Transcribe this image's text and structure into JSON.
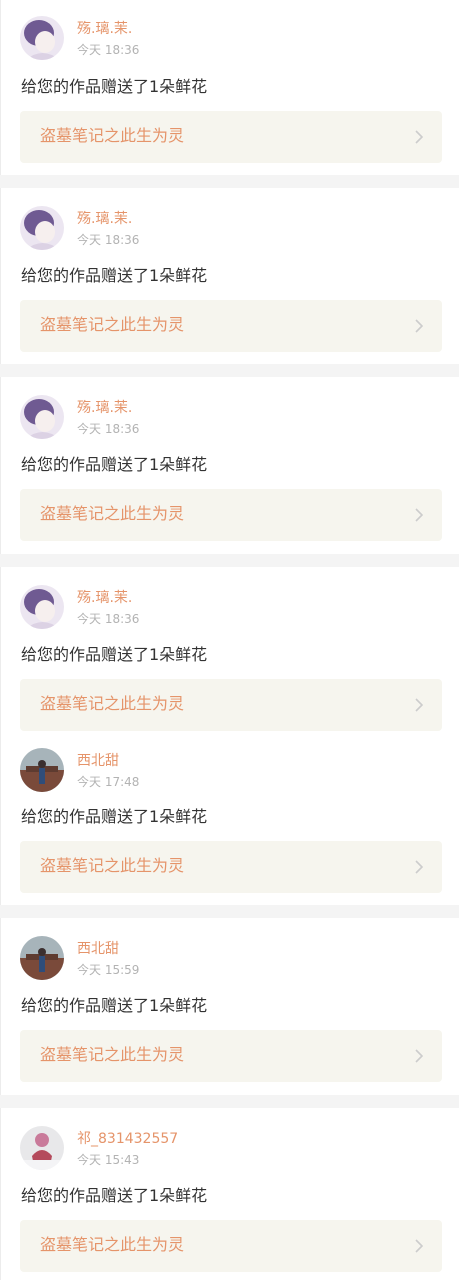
{
  "colors": {
    "background": "#f4f4f4",
    "entry_background": "#ffffff",
    "accent": "#e5946a",
    "card_background": "#f6f5ee",
    "timestamp": "#b3b3b3",
    "message": "#333333",
    "chevron": "#cccccc"
  },
  "entries": [
    {
      "avatar": "avatar-purple-hair-icon",
      "username": "殇.璃.茉.",
      "time": "今天 18:36",
      "message": "给您的作品赠送了1朵鲜花",
      "work_title": "盗墓笔记之此生为灵"
    },
    {
      "avatar": "avatar-purple-hair-icon",
      "username": "殇.璃.茉.",
      "time": "今天 18:36",
      "message": "给您的作品赠送了1朵鲜花",
      "work_title": "盗墓笔记之此生为灵"
    },
    {
      "avatar": "avatar-purple-hair-icon",
      "username": "殇.璃.茉.",
      "time": "今天 18:36",
      "message": "给您的作品赠送了1朵鲜花",
      "work_title": "盗墓笔记之此生为灵"
    },
    {
      "avatar": "avatar-purple-hair-icon",
      "username": "殇.璃.茉.",
      "time": "今天 18:36",
      "message": "给您的作品赠送了1朵鲜花",
      "work_title": "盗墓笔记之此生为灵"
    },
    {
      "avatar": "avatar-outdoor-photo-icon",
      "username": "西北甜",
      "time": "今天 17:48",
      "message": "给您的作品赠送了1朵鲜花",
      "work_title": "盗墓笔记之此生为灵"
    },
    {
      "avatar": "avatar-outdoor-photo-icon",
      "username": "西北甜",
      "time": "今天 15:59",
      "message": "给您的作品赠送了1朵鲜花",
      "work_title": "盗墓笔记之此生为灵"
    },
    {
      "avatar": "avatar-snow-scene-icon",
      "username": "祁_831432557",
      "time": "今天 15:43",
      "message": "给您的作品赠送了1朵鲜花",
      "work_title": "盗墓笔记之此生为灵"
    }
  ]
}
